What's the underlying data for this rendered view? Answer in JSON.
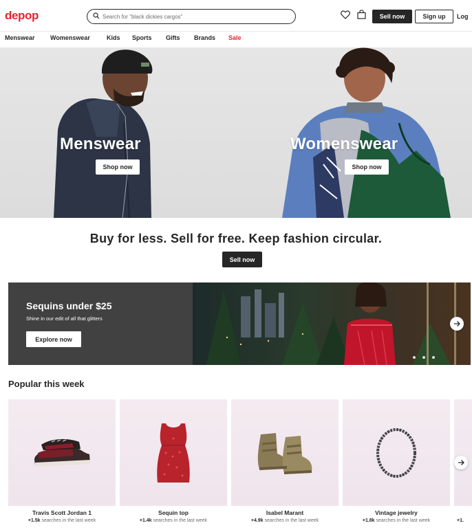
{
  "header": {
    "logo": "depop",
    "search_placeholder": "Search for \"black dickies cargos\"",
    "sell_label": "Sell now",
    "signup_label": "Sign up",
    "login_label": "Log"
  },
  "nav": {
    "items": [
      "Menswear",
      "Womenswear",
      "Kids",
      "Sports",
      "Gifts",
      "Brands",
      "Sale"
    ]
  },
  "hero": {
    "menswear_title": "Menswear",
    "menswear_btn": "Shop now",
    "womenswear_title": "Womenswear",
    "womenswear_btn": "Shop now"
  },
  "tagline": {
    "text": "Buy for less. Sell for free. Keep fashion circular.",
    "button": "Sell now"
  },
  "promo": {
    "title": "Sequins under $25",
    "subtitle": "Shine in our edit of all that glitters",
    "button": "Explore now"
  },
  "popular": {
    "title": "Popular this week",
    "items": [
      {
        "name": "Travis Scott Jordan 1",
        "count": "+1.5k",
        "suffix": " searches in the last week"
      },
      {
        "name": "Sequin top",
        "count": "+1.4k",
        "suffix": " searches in the last week"
      },
      {
        "name": "Isabel Marant",
        "count": "+4.9k",
        "suffix": " searches in the last week"
      },
      {
        "name": "Vintage jewelry",
        "count": "+1.8k",
        "suffix": " searches in the last week"
      },
      {
        "name": "",
        "count": "+1.",
        "suffix": ""
      }
    ]
  },
  "colors": {
    "brand_red": "#e0262f",
    "dark": "#262626",
    "banner_gray": "#414141",
    "card_bg": "#f4ebf1"
  }
}
